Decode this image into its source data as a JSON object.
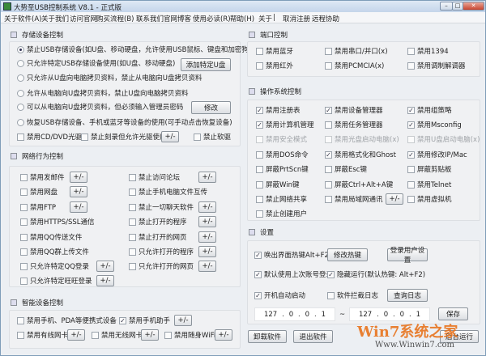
{
  "window": {
    "title": "大势至USB控制系统 V8.1 - 正式版",
    "min": "–",
    "max": "□",
    "close": "✕"
  },
  "menu": [
    "关于软件(A)",
    "关于我们",
    "访问官网",
    "购买流程(B)",
    "联系我们",
    "官网博客",
    "使用必读(R)",
    "帮助(H)",
    "关于",
    "|",
    "取消注册",
    "远程协助"
  ],
  "pm": "+/-",
  "storage": {
    "title": "存储设备控制",
    "options": [
      {
        "label": "禁止USB存储设备(如U盘、移动硬盘，允许使用USB鼠标、键盘和加密狗)",
        "selected": true
      },
      {
        "label": "只允许特定USB存储设备使用(如U盘、移动硬盘)",
        "selected": false
      },
      {
        "label": "只允许从U盘向电脑拷贝资料，禁止从电脑向U盘拷贝资料",
        "selected": false
      },
      {
        "label": "允许从电脑向U盘拷贝资料，禁止U盘向电脑拷贝资料",
        "selected": false
      },
      {
        "label": "可以从电脑向U盘拷贝资料，但必须输入管理员密码",
        "selected": false
      },
      {
        "label": "恢复USB存储设备、手机或蓝牙等设备的使用(可手动点击恢复设备)",
        "selected": false
      }
    ],
    "add_button": "添加特定U盘",
    "modify_button": "修改",
    "checks": [
      {
        "label": "禁用CD/DVD光驱",
        "checked": false
      },
      {
        "label": "禁止刻录但允许光驱使用",
        "checked": false
      },
      {
        "label": "禁止软驱",
        "checked": false
      }
    ]
  },
  "network": {
    "title": "网络行为控制",
    "left": [
      {
        "label": "禁用发邮件",
        "checked": false
      },
      {
        "label": "禁用网盘",
        "checked": false
      },
      {
        "label": "禁用FTP",
        "checked": false
      },
      {
        "label": "禁用HTTPS/SSL通信",
        "checked": false
      },
      {
        "label": "禁用QQ传送文件",
        "checked": false
      },
      {
        "label": "禁用QQ群上传文件",
        "checked": false
      },
      {
        "label": "只允许特定QQ登录",
        "checked": false
      },
      {
        "label": "只允许特定旺旺登录",
        "checked": false
      }
    ],
    "right": [
      {
        "label": "禁止访问论坛",
        "checked": false
      },
      {
        "label": "禁止手机电脑文件互传",
        "checked": false
      },
      {
        "label": "禁止一切聊天软件",
        "checked": false
      },
      {
        "label": "禁止打开的程序",
        "checked": false
      },
      {
        "label": "禁止打开的网页",
        "checked": false
      },
      {
        "label": "只允许打开的程序",
        "checked": false
      },
      {
        "label": "只允许打开的网页",
        "checked": false
      }
    ]
  },
  "smart": {
    "title": "智能设备控制",
    "items": [
      {
        "label": "禁用手机、PDA等便携式设备",
        "checked": false
      },
      {
        "label": "禁用手机助手",
        "checked": true
      },
      {
        "label": "禁用有线网卡",
        "checked": false
      },
      {
        "label": "禁用无线网卡",
        "checked": false
      },
      {
        "label": "禁用随身WiFi",
        "checked": false
      }
    ]
  },
  "ports": {
    "title": "端口控制",
    "items": [
      {
        "label": "禁用蓝牙",
        "checked": false
      },
      {
        "label": "禁用串口/并口(x)",
        "checked": false
      },
      {
        "label": "禁用1394",
        "checked": false
      },
      {
        "label": "禁用红外",
        "checked": false
      },
      {
        "label": "禁用PCMCIA(x)",
        "checked": false
      },
      {
        "label": "禁用调制解调器",
        "checked": false
      }
    ]
  },
  "os": {
    "title": "操作系统控制",
    "items": [
      {
        "label": "禁用注册表",
        "checked": true
      },
      {
        "label": "禁用设备管理器",
        "checked": true
      },
      {
        "label": "禁用组策略",
        "checked": true
      },
      {
        "label": "禁用计算机管理",
        "checked": true
      },
      {
        "label": "禁用任务管理器",
        "checked": false
      },
      {
        "label": "禁用Msconfig",
        "checked": true
      },
      {
        "label": "禁用安全模式",
        "checked": false,
        "disabled": true
      },
      {
        "label": "禁用光盘启动电脑(x)",
        "checked": false,
        "disabled": true
      },
      {
        "label": "禁用U盘启动电脑(x)",
        "checked": false,
        "disabled": true
      },
      {
        "label": "禁用DOS命令",
        "checked": false
      },
      {
        "label": "禁用格式化和Ghost",
        "checked": true
      },
      {
        "label": "禁用修改IP/Mac",
        "checked": true
      },
      {
        "label": "屏蔽PrtScn键",
        "checked": false
      },
      {
        "label": "屏蔽Esc键",
        "checked": false
      },
      {
        "label": "屏蔽剪贴板",
        "checked": false
      },
      {
        "label": "屏蔽Win键",
        "checked": false
      },
      {
        "label": "屏蔽Ctrl+Alt+A键",
        "checked": false
      },
      {
        "label": "禁用Telnet",
        "checked": false
      },
      {
        "label": "禁止网络共享",
        "checked": false
      },
      {
        "label": "禁用局域网通讯",
        "checked": false
      },
      {
        "label": "禁用虚拟机",
        "checked": false
      },
      {
        "label": "禁止创建用户",
        "checked": false
      }
    ]
  },
  "settings": {
    "title": "设置",
    "items": [
      {
        "label": "唤出界面热键Alt+F2",
        "checked": true
      },
      {
        "label": "默认使用上次账号登录",
        "checked": true
      },
      {
        "label": "隐藏运行(默认热键: Alt+F2)",
        "checked": true
      },
      {
        "label": "开机自动启动",
        "checked": true
      },
      {
        "label": "软件拦截日志",
        "checked": false
      }
    ],
    "modify_hotkey": "修改热键",
    "login_settings": "登录用户设置",
    "view_log": "查询日志",
    "ip_start": [
      "127",
      ".",
      "0",
      ".",
      "0",
      ".",
      "1"
    ],
    "ip_sep": "~",
    "ip_end": [
      "127",
      ".",
      "0",
      ".",
      "0",
      ".",
      "1"
    ],
    "save": "保存"
  },
  "bottom": {
    "uninstall": "卸载软件",
    "exit": "退出软件",
    "background": "后台运行"
  },
  "watermark": {
    "brand": "Win7系统之家",
    "url": "Www.Winwin7.com"
  }
}
